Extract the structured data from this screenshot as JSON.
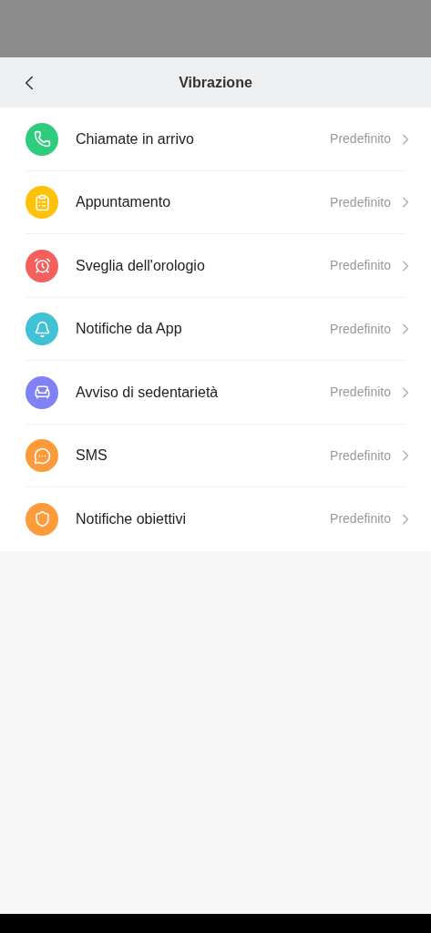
{
  "header": {
    "title": "Vibrazione"
  },
  "items": [
    {
      "label": "Chiamate in arrivo",
      "value": "Predefinito",
      "kind": "phone",
      "color": "#2ecc7f"
    },
    {
      "label": "Appuntamento",
      "value": "Predefinito",
      "kind": "clipboard",
      "color": "#fdc107"
    },
    {
      "label": "Sveglia dell'orologio",
      "value": "Predefinito",
      "kind": "alarm",
      "color": "#f4605b"
    },
    {
      "label": "Notifiche da App",
      "value": "Predefinito",
      "kind": "bell",
      "color": "#3fc1d6"
    },
    {
      "label": "Avviso di sedentarietà",
      "value": "Predefinito",
      "kind": "armchair",
      "color": "#7f81f4"
    },
    {
      "label": "SMS",
      "value": "Predefinito",
      "kind": "message",
      "color": "#fd9b3a"
    },
    {
      "label": "Notifiche obiettivi",
      "value": "Predefinito",
      "kind": "shield",
      "color": "#fd9b3a"
    }
  ]
}
